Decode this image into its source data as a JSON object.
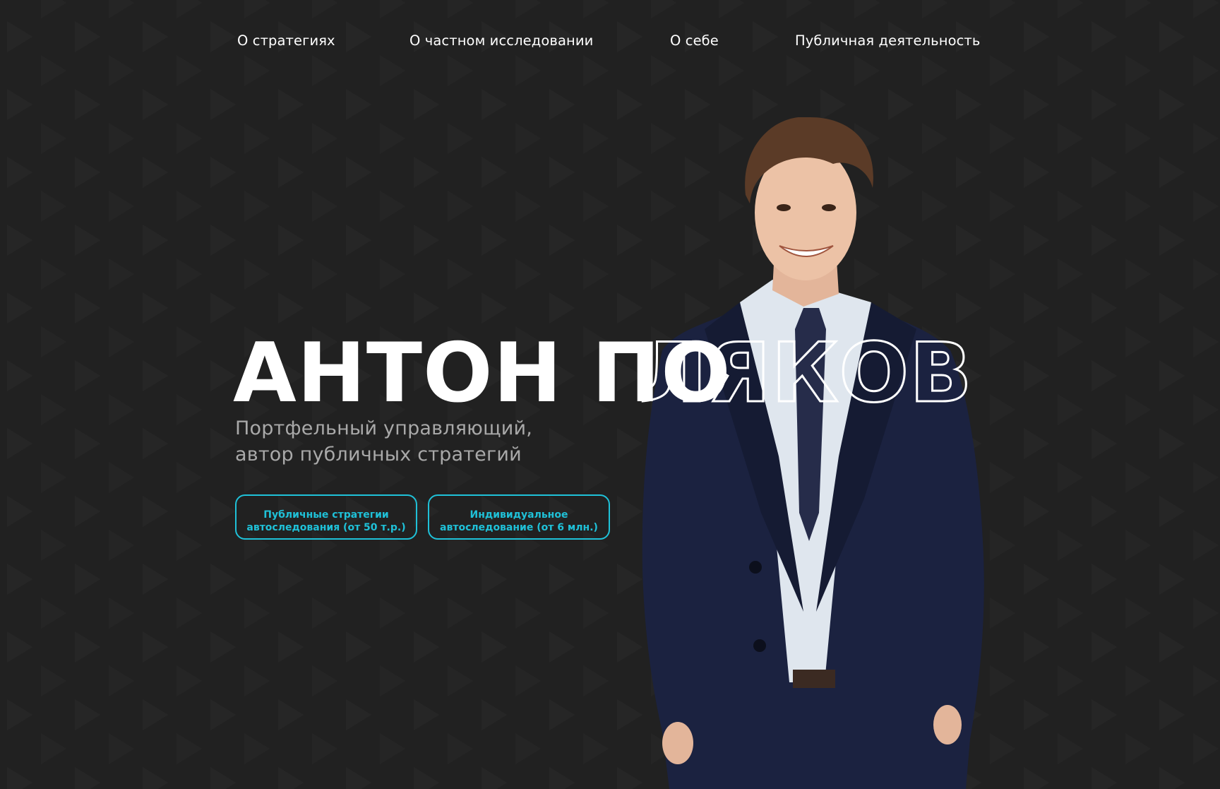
{
  "nav": {
    "items": [
      {
        "label": "О стратегиях"
      },
      {
        "label": "О частном исследовании"
      },
      {
        "label": "О себе"
      },
      {
        "label": "Публичная деятельность"
      }
    ]
  },
  "hero": {
    "title_solid": "АНТОН ПО",
    "title_outline": "ЛЯКОВ",
    "subtitle_line1": "Портфельный управляющий,",
    "subtitle_line2": "автор публичных стратегий",
    "buttons": [
      {
        "line1": "Публичные стратегии",
        "line2": "автоследования (от 50 т.р.)"
      },
      {
        "line1": "Индивидуальное",
        "line2": "автоследование (от 6 млн.)"
      }
    ]
  },
  "colors": {
    "background": "#212121",
    "accent": "#1fc1d8",
    "text": "#ffffff",
    "subtitle": "#a9a9a9"
  }
}
